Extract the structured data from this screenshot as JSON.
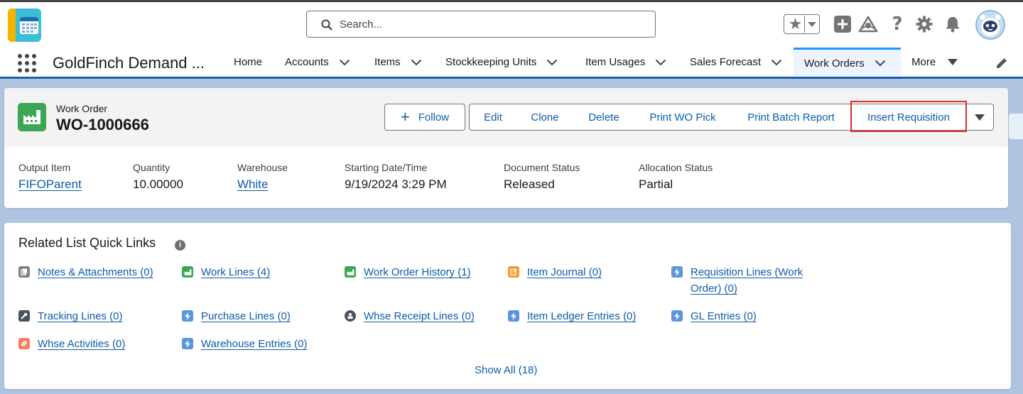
{
  "header": {
    "search_placeholder": "Search..."
  },
  "nav": {
    "app_name": "GoldFinch Demand ...",
    "items": [
      {
        "label": "Home"
      },
      {
        "label": "Accounts"
      },
      {
        "label": "Items"
      },
      {
        "label": "Stockkeeping Units"
      },
      {
        "label": "Item Usages"
      },
      {
        "label": "Sales Forecast"
      },
      {
        "label": "Work Orders"
      },
      {
        "label": "More"
      }
    ],
    "active": "Work Orders"
  },
  "record": {
    "object_label": "Work Order",
    "name": "WO-1000666",
    "buttons": {
      "follow": "Follow",
      "edit": "Edit",
      "clone": "Clone",
      "delete": "Delete",
      "print_wo_pick": "Print WO Pick",
      "print_batch_report": "Print Batch Report",
      "insert_requisition": "Insert Requisition"
    },
    "fields": [
      {
        "label": "Output Item",
        "value": "FIFOParent"
      },
      {
        "label": "Quantity",
        "value": "10.00000"
      },
      {
        "label": "Warehouse",
        "value": "White"
      },
      {
        "label": "Starting Date/Time",
        "value": "9/19/2024 3:29 PM"
      },
      {
        "label": "Document Status",
        "value": "Released"
      },
      {
        "label": "Allocation Status",
        "value": "Partial"
      }
    ]
  },
  "related": {
    "title": "Related List Quick Links",
    "links": [
      {
        "label": "Notes & Attachments (0)",
        "color": "#7e8083"
      },
      {
        "label": "Work Lines (4)",
        "color": "#3ba755"
      },
      {
        "label": "Work Order History (1)",
        "color": "#3ba755"
      },
      {
        "label": "Item Journal (0)",
        "color": "#f49b29"
      },
      {
        "label": "Requisition Lines (Work Order) (0)",
        "color": "#5a95dd"
      },
      {
        "label": "Tracking Lines (0)",
        "color": "#4b5260"
      },
      {
        "label": "Purchase Lines (0)",
        "color": "#5a95dd"
      },
      {
        "label": "Whse Receipt Lines (0)",
        "color": "#4b5260"
      },
      {
        "label": "Item Ledger Entries (0)",
        "color": "#5a95dd"
      },
      {
        "label": "GL Entries (0)",
        "color": "#5a95dd"
      },
      {
        "label": "Whse Activities (0)",
        "color": "#f27f66"
      },
      {
        "label": "Warehouse Entries (0)",
        "color": "#5a95dd"
      }
    ],
    "show_all": "Show All (18)"
  },
  "colors": {
    "brand_blue": "#0b5cab",
    "nav_active": "#1b96ff",
    "highlight_box": "#e02c2c",
    "object_icon": "#3ba755"
  }
}
